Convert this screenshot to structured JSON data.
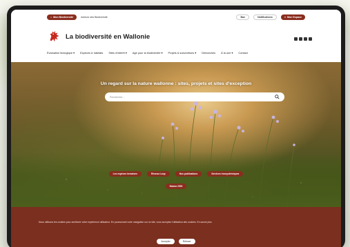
{
  "topbar": {
    "pill_left": "Mon Biodiversité",
    "link_actors": "Acteurs des Biodiversité",
    "btn_fr": "Bav",
    "btn_notif": "Notifications",
    "pill_right": "Mon Espace"
  },
  "header": {
    "site_title": "La biodiversité en Wallonie",
    "brand_color": "#8a2d1e"
  },
  "nav": {
    "items": [
      "Évaluation biologique ▾",
      "Espèces & habitats",
      "Sites d'intérêt ▾",
      "Agir pour la biodiversité ▾",
      "Projets & subventions ▾",
      "Démarches",
      "À la une ▾",
      "Contact"
    ]
  },
  "hero": {
    "title": "Un regard sur la nature wallonne : sites, projets et sites d'exception",
    "search_placeholder": "Recherche..."
  },
  "chips": {
    "row1": [
      "Les espèces invasives",
      "Réseau Loup",
      "Nos publications",
      "Services écosystémiques"
    ],
    "row2": [
      "Natura 2000"
    ]
  },
  "cookie": {
    "text": "Nous utilisons les cookies pour améliorer votre expérience utilisateur. En poursuivant votre navigation sur ce site, vous acceptez l'utilisation des cookies. En savoir plus",
    "accept": "Accepter",
    "refuse": "Refuser"
  }
}
